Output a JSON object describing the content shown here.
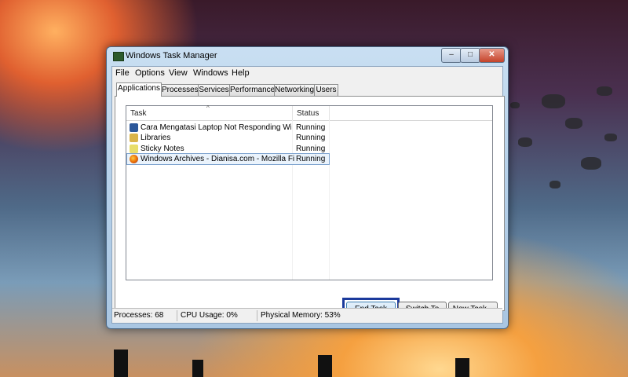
{
  "window": {
    "title": "Windows Task Manager",
    "controls": {
      "minimize": "–",
      "maximize": "□",
      "close": "✕"
    }
  },
  "menu": [
    "File",
    "Options",
    "View",
    "Windows",
    "Help"
  ],
  "tabs": [
    "Applications",
    "Processes",
    "Services",
    "Performance",
    "Networking",
    "Users"
  ],
  "active_tab": "Applications",
  "table": {
    "columns": [
      "Task",
      "Status"
    ],
    "sort_indicator": "^",
    "rows": [
      {
        "task": "Cara Mengatasi Laptop Not Responding Window...",
        "status": "Running",
        "icon": "word-document-icon",
        "icon_color": "#2b579a"
      },
      {
        "task": "Libraries",
        "status": "Running",
        "icon": "libraries-folder-icon",
        "icon_color": "#d9b44a"
      },
      {
        "task": "Sticky Notes",
        "status": "Running",
        "icon": "sticky-notes-icon",
        "icon_color": "#e8de6a"
      },
      {
        "task": "Windows Archives - Dianisa.com - Mozilla Firefox",
        "status": "Running",
        "icon": "firefox-icon",
        "icon_color": "#e66000",
        "selected": true
      }
    ]
  },
  "buttons": {
    "end_task": "End Task",
    "switch_to": "Switch To",
    "new_task": "New Task..."
  },
  "status_bar": {
    "processes": "Processes: 68",
    "cpu_usage": "CPU Usage: 0%",
    "physical_memory": "Physical Memory: 53%"
  },
  "colors": {
    "highlight_border": "#1b3a9c",
    "selection": "#eaf3fc"
  }
}
